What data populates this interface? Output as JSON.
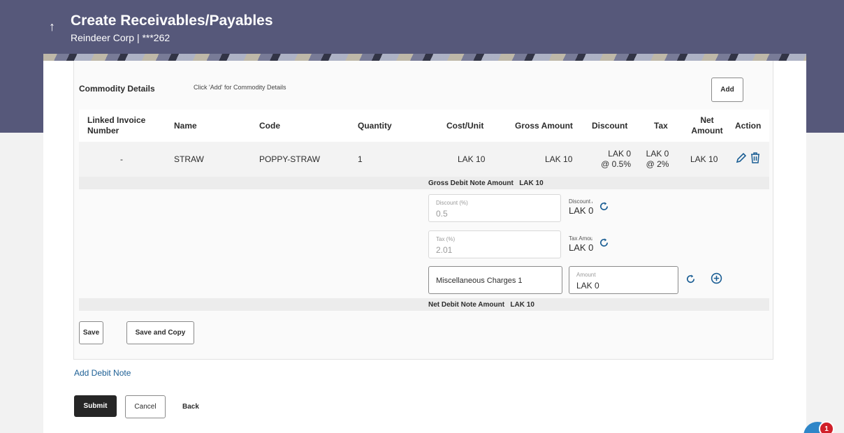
{
  "header": {
    "title": "Create Receivables/Payables",
    "subtitle": "Reindeer Corp | ***262"
  },
  "commodity": {
    "title": "Commodity Details",
    "hint": "Click 'Add' for Commodity Details",
    "add_label": "Add"
  },
  "table": {
    "columns": {
      "linked_invoice": "Linked Invoice Number",
      "name": "Name",
      "code": "Code",
      "quantity": "Quantity",
      "cost_unit": "Cost/Unit",
      "gross_amount": "Gross Amount",
      "discount": "Discount",
      "tax": "Tax",
      "net_amount": "Net Amount",
      "action": "Action"
    },
    "row": {
      "linked_invoice": "-",
      "name": "STRAW",
      "code": "POPPY-STRAW",
      "quantity": "1",
      "cost_unit": "LAK 10",
      "gross_amount": "LAK 10",
      "discount_amount": "LAK 0",
      "discount_rate": "@ 0.5%",
      "tax_amount": "LAK 0",
      "tax_rate": "@ 2%",
      "net_amount": "LAK 10"
    }
  },
  "breakdown": {
    "gross_label": "Gross Debit Note Amount",
    "gross_value": "LAK 10",
    "discount_pct_label": "Discount (%)",
    "discount_pct_value": "0.5",
    "discount_amt_label": "Discount Amount",
    "discount_amt_value": "LAK 0",
    "tax_pct_label": "Tax (%)",
    "tax_pct_value": "2.01",
    "tax_amt_label": "Tax Amount",
    "tax_amt_value": "LAK 0",
    "misc_label": "Miscellaneous Charges 1",
    "misc_amount_label": "Amount",
    "misc_amount_value": "LAK 0",
    "net_label": "Net Debit Note Amount",
    "net_value": "LAK 10"
  },
  "card_actions": {
    "save": "Save",
    "save_copy": "Save and Copy"
  },
  "add_debit_note": "Add Debit Note",
  "footer": {
    "submit": "Submit",
    "cancel": "Cancel",
    "back": "Back"
  },
  "notification_count": "1",
  "colors": {
    "header_bg": "#56587a",
    "link": "#1b5e94",
    "primary_button": "#262626",
    "badge": "#d0202a"
  },
  "icons": [
    "back-arrow-icon",
    "edit-icon",
    "delete-icon",
    "refresh-icon",
    "add-circle-icon",
    "chat-icon"
  ]
}
